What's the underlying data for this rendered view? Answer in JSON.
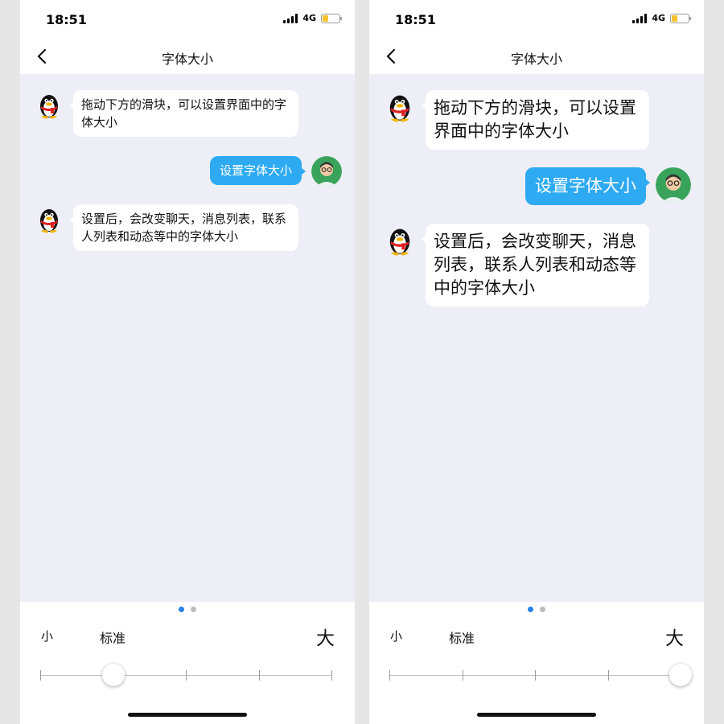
{
  "screens": [
    {
      "status": {
        "time": "18:51",
        "network": "4G"
      },
      "nav": {
        "title": "字体大小"
      },
      "messages": [
        {
          "from": "bot",
          "text": "拖动下方的滑块，可以设置界面中的字体大小"
        },
        {
          "from": "user",
          "text": "设置字体大小"
        },
        {
          "from": "bot",
          "text": "设置后，会改变聊天，消息列表，联系人列表和动态等中的字体大小"
        }
      ],
      "slider": {
        "small_label": "小",
        "standard_label": "标准",
        "large_label": "大",
        "step_count": 5,
        "selected_index": 1
      },
      "page_indicator": {
        "count": 2,
        "active": 0
      }
    },
    {
      "status": {
        "time": "18:51",
        "network": "4G"
      },
      "nav": {
        "title": "字体大小"
      },
      "messages": [
        {
          "from": "bot",
          "text": "拖动下方的滑块，可以设置界面中的字体大小"
        },
        {
          "from": "user",
          "text": "设置字体大小"
        },
        {
          "from": "bot",
          "text": "设置后，会改变聊天，消息列表，联系人列表和动态等中的字体大小"
        }
      ],
      "slider": {
        "small_label": "小",
        "standard_label": "标准",
        "large_label": "大",
        "step_count": 5,
        "selected_index": 4
      },
      "page_indicator": {
        "count": 2,
        "active": 0
      }
    }
  ],
  "colors": {
    "accent": "#2684e6",
    "sent_bubble": "#2eaaf2",
    "chat_bg": "#edeef6"
  }
}
